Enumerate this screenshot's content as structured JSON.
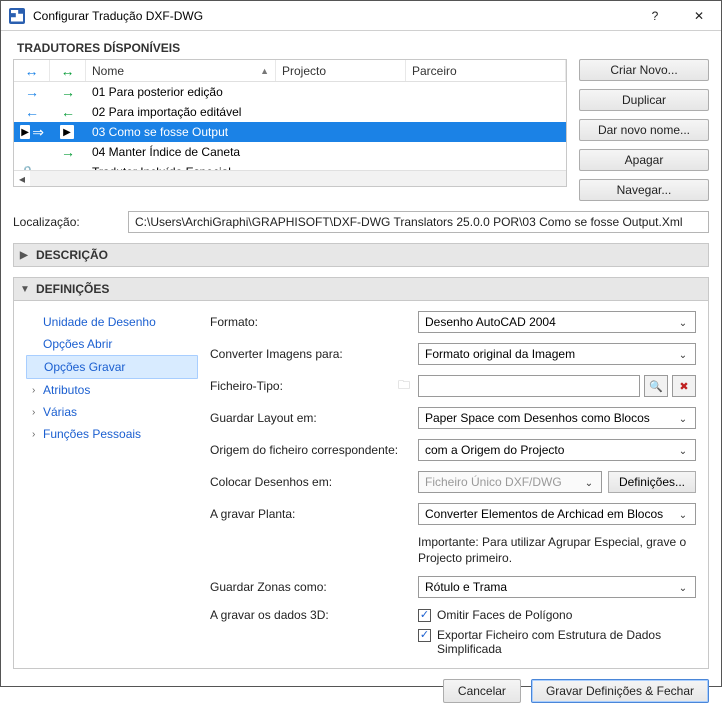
{
  "window": {
    "title": "Configurar Tradução DXF-DWG",
    "help": "?",
    "close": "✕"
  },
  "translators": {
    "heading": "TRADUTORES DÍSPONÍVEIS",
    "cols": {
      "name": "Nome",
      "project": "Projecto",
      "partner": "Parceiro"
    },
    "rows": [
      {
        "name": "01 Para posterior edição",
        "in": "→",
        "out": "→",
        "sel": false
      },
      {
        "name": "02 Para importação editável",
        "in": "←",
        "out": "←",
        "sel": false
      },
      {
        "name": "03 Como se fosse Output",
        "in": "▶ ⇒",
        "out": "▶",
        "sel": true
      },
      {
        "name": "04 Manter Índice de Caneta",
        "in": "",
        "out": "→",
        "sel": false
      },
      {
        "name": "Tradutor Incluído Especial",
        "in": "",
        "out": "↔",
        "sel": false,
        "lock": true
      }
    ]
  },
  "buttons": {
    "new": "Criar Novo...",
    "duplicate": "Duplicar",
    "rename": "Dar novo nome...",
    "delete": "Apagar",
    "browse": "Navegar..."
  },
  "location": {
    "label": "Localização:",
    "value": "C:\\Users\\ArchiGraphi\\GRAPHISOFT\\DXF-DWG Translators 25.0.0 POR\\03 Como se fosse Output.Xml"
  },
  "sections": {
    "description": "DESCRIÇÃO",
    "definitions": "DEFINIÇÕES"
  },
  "nav": {
    "items": [
      {
        "label": "Unidade de Desenho",
        "expandable": false
      },
      {
        "label": "Opções Abrir",
        "expandable": false
      },
      {
        "label": "Opções Gravar",
        "expandable": false,
        "selected": true
      },
      {
        "label": "Atributos",
        "expandable": true
      },
      {
        "label": "Várias",
        "expandable": true
      },
      {
        "label": "Funções Pessoais",
        "expandable": true
      }
    ]
  },
  "form": {
    "format_label": "Formato:",
    "format_value": "Desenho AutoCAD 2004",
    "convimg_label": "Converter Imagens para:",
    "convimg_value": "Formato original da Imagem",
    "filetype_label": "Ficheiro-Tipo:",
    "savelayout_label": "Guardar Layout em:",
    "savelayout_value": "Paper Space com Desenhos como Blocos",
    "origin_label": "Origem do ficheiro correspondente:",
    "origin_value": "com a Origem do Projecto",
    "placedrawings_label": "Colocar Desenhos em:",
    "placedrawings_value": "Ficheiro Único DXF/DWG",
    "placedrawings_settings": "Definições...",
    "savingplan_label": "A gravar Planta:",
    "savingplan_value": "Converter Elementos de Archicad em Blocos",
    "note": "Importante: Para utilizar Agrupar Especial, grave o Projecto primeiro.",
    "savezones_label": "Guardar Zonas como:",
    "savezones_value": "Rótulo e Trama",
    "save3d_label": "A gravar os dados 3D:",
    "cb_omit": "Omitir Faces de Polígono",
    "cb_export": "Exportar Ficheiro com Estrutura de Dados Simplificada"
  },
  "footer": {
    "cancel": "Cancelar",
    "save": "Gravar Definições & Fechar"
  }
}
